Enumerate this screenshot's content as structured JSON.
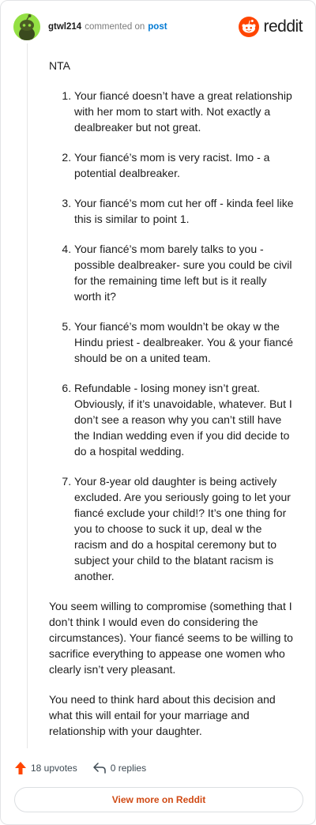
{
  "header": {
    "username": "gtwl214",
    "action": "commented on",
    "post_link": "post",
    "brand": "reddit",
    "avatar_color": "#94e044",
    "brand_color": "#ff4500"
  },
  "comment": {
    "opening": "NTA",
    "points": [
      "Your fiancé doesn’t have a great relationship with her mom to start with. Not exactly a dealbreaker but not great.",
      "Your fiancé’s mom is very racist. Imo - a potential dealbreaker.",
      "Your fiancé’s mom cut her off - kinda feel like this is similar to point 1.",
      "Your fiancé’s mom barely talks to you - possible dealbreaker- sure you could be civil for the remaining time left but is it really worth it?",
      "Your fiancé’s mom wouldn’t be okay w the Hindu priest - dealbreaker. You & your fiancé should be on a united team.",
      "Refundable - losing money isn’t great. Obviously, if it’s unavoidable, whatever. But I don’t see a reason why you can’t still have the Indian wedding even if you did decide to do a hospital wedding.",
      "Your 8-year old daughter is being actively excluded. Are you seriously going to let your fiancé exclude your child!? It’s one thing for you to choose to suck it up, deal w the racism and do a hospital ceremony but to subject your child to the blatant racism is another."
    ],
    "para1": "You seem willing to compromise (something that I don’t think I would even do considering the circumstances). Your fiancé seems to be willing to sacrifice everything to appease one women who clearly isn’t very pleasant.",
    "para2": "You need to think hard about this decision and what this will entail for your marriage and relationship with your daughter."
  },
  "footer": {
    "upvotes": "18 upvotes",
    "replies": "0 replies",
    "view_more": "View more on Reddit",
    "upvote_color": "#ff4500"
  }
}
